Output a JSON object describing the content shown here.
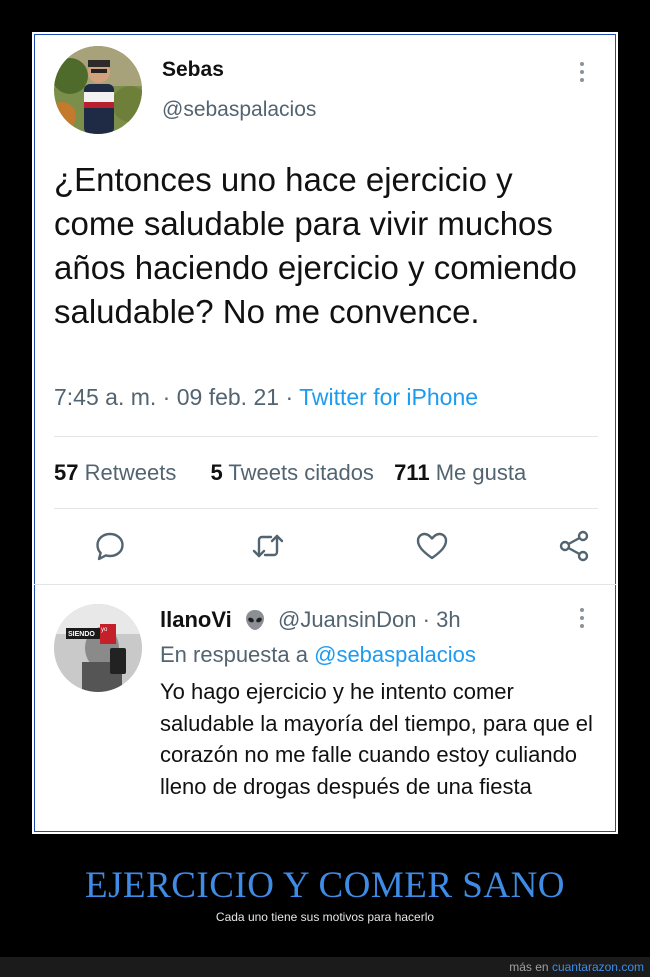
{
  "tweet": {
    "author_name": "Sebas",
    "author_handle": "@sebaspalacios",
    "text": "¿Entonces uno hace ejercicio y come saludable para vivir muchos años haciendo ejercicio y comiendo saludable? No me convence.",
    "time": "7:45 a. m.",
    "date": "09 feb. 21",
    "source": "Twitter for iPhone",
    "retweets_count": "57",
    "retweets_label": "Retweets",
    "quotes_count": "5",
    "quotes_label": "Tweets citados",
    "likes_count": "711",
    "likes_label": "Me gusta",
    "action_icons": [
      "reply-icon",
      "retweet-icon",
      "like-icon",
      "share-icon"
    ]
  },
  "reply": {
    "author_name": "llanoVi",
    "author_emoji": "alien-icon",
    "author_handle": "@JuansinDon",
    "age": "3h",
    "in_reply_prefix": "En respuesta a",
    "in_reply_mention": "@sebaspalacios",
    "text": "Yo hago ejercicio y he intento comer saludable la mayoría del tiempo, para que el corazón no me falle cuando estoy culiando lleno de drogas después de una fiesta",
    "avatar_text": [
      "SIENDO",
      "yo"
    ]
  },
  "caption": {
    "title": "EJERCICIO Y COMER SANO",
    "subtitle": "Cada uno tiene sus motivos para hacerlo"
  },
  "footer": {
    "prefix": "más en",
    "site": "cuantarazon.com"
  },
  "colors": {
    "link": "#1d9bf0",
    "caption": "#3f8ce6",
    "muted": "#536471"
  }
}
